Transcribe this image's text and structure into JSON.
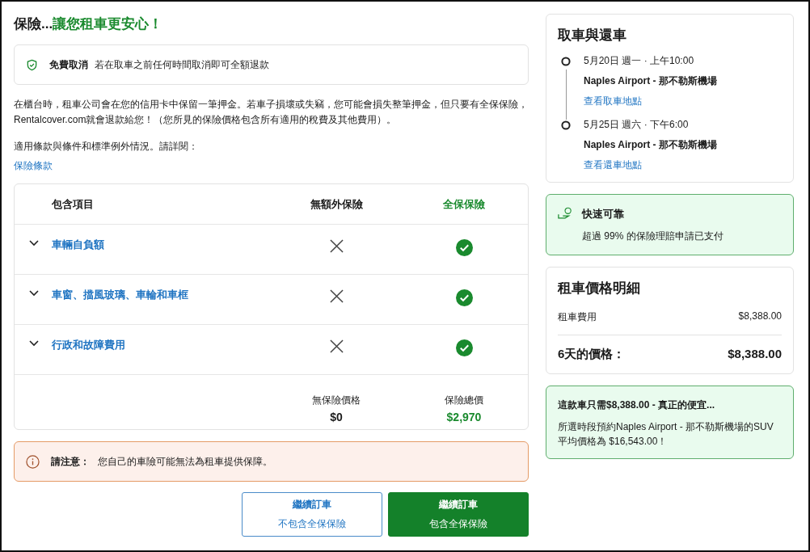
{
  "heading": {
    "lead": "保險...",
    "highlight": "讓您租車更安心！"
  },
  "cancellation": {
    "title": "免費取消",
    "text": "若在取車之前任何時間取消即可全額退款"
  },
  "deposit_text": "在櫃台時，租車公司會在您的信用卡中保留一筆押金。若車子損壞或失竊，您可能會損失整筆押金，但只要有全保保險，Rentalcover.com就會退款給您！（您所見的保險價格包含所有適用的稅費及其他費用）。",
  "terms_text": "適用條款與條件和標準例外情況。請詳閱：",
  "terms_link": "保險條款",
  "comparison": {
    "columns": [
      "包含項目",
      "無額外保險",
      "全保保險"
    ],
    "rows": [
      {
        "item": "車輛自負額",
        "expanded": false,
        "no_insurance": false,
        "full_cover": true
      },
      {
        "item": "車窗、擋風玻璃、車輪和車框",
        "expanded": false,
        "no_insurance": false,
        "full_cover": true
      },
      {
        "item": "行政和故障費用",
        "expanded": false,
        "no_insurance": false,
        "full_cover": true
      }
    ],
    "totals": [
      {
        "label": "無保險價格",
        "price": "$0",
        "highlight": false
      },
      {
        "label": "保險總價",
        "price": "$2,970",
        "highlight": true
      }
    ]
  },
  "notice": {
    "title": "請注意：",
    "text": "您自己的車險可能無法為租車提供保障。"
  },
  "buttons": [
    {
      "kind": "outline",
      "title": "繼續訂車",
      "subtitle": "不包含全保保險"
    },
    {
      "kind": "primary",
      "title": "繼續訂車",
      "subtitle": "包含全保保險"
    }
  ],
  "pickup_return": {
    "title": "取車與還車",
    "stops": [
      {
        "datetime": "5月20日 週一 · 上午10:00",
        "location": "Naples Airport - 那不勒斯機場",
        "link": "查看取車地點"
      },
      {
        "datetime": "5月25日 週六 · 下午6:00",
        "location": "Naples Airport - 那不勒斯機場",
        "link": "查看還車地點"
      }
    ]
  },
  "reliability": {
    "title": "快速可靠",
    "text": "超過 99% 的保險理賠申請已支付"
  },
  "price_breakdown": {
    "title": "租車價格明細",
    "lines": [
      {
        "label": "租車費用",
        "amount": "$8,388.00",
        "kind": "item"
      },
      {
        "label": "6天的價格：",
        "amount": "$8,388.00",
        "kind": "total"
      }
    ]
  },
  "deal": {
    "title": "這款車只需$8,388.00 - 真正的便宜...",
    "text": "所選時段預約Naples Airport - 那不勒斯機場的SUV 平均價格為 $16,543.00！"
  }
}
